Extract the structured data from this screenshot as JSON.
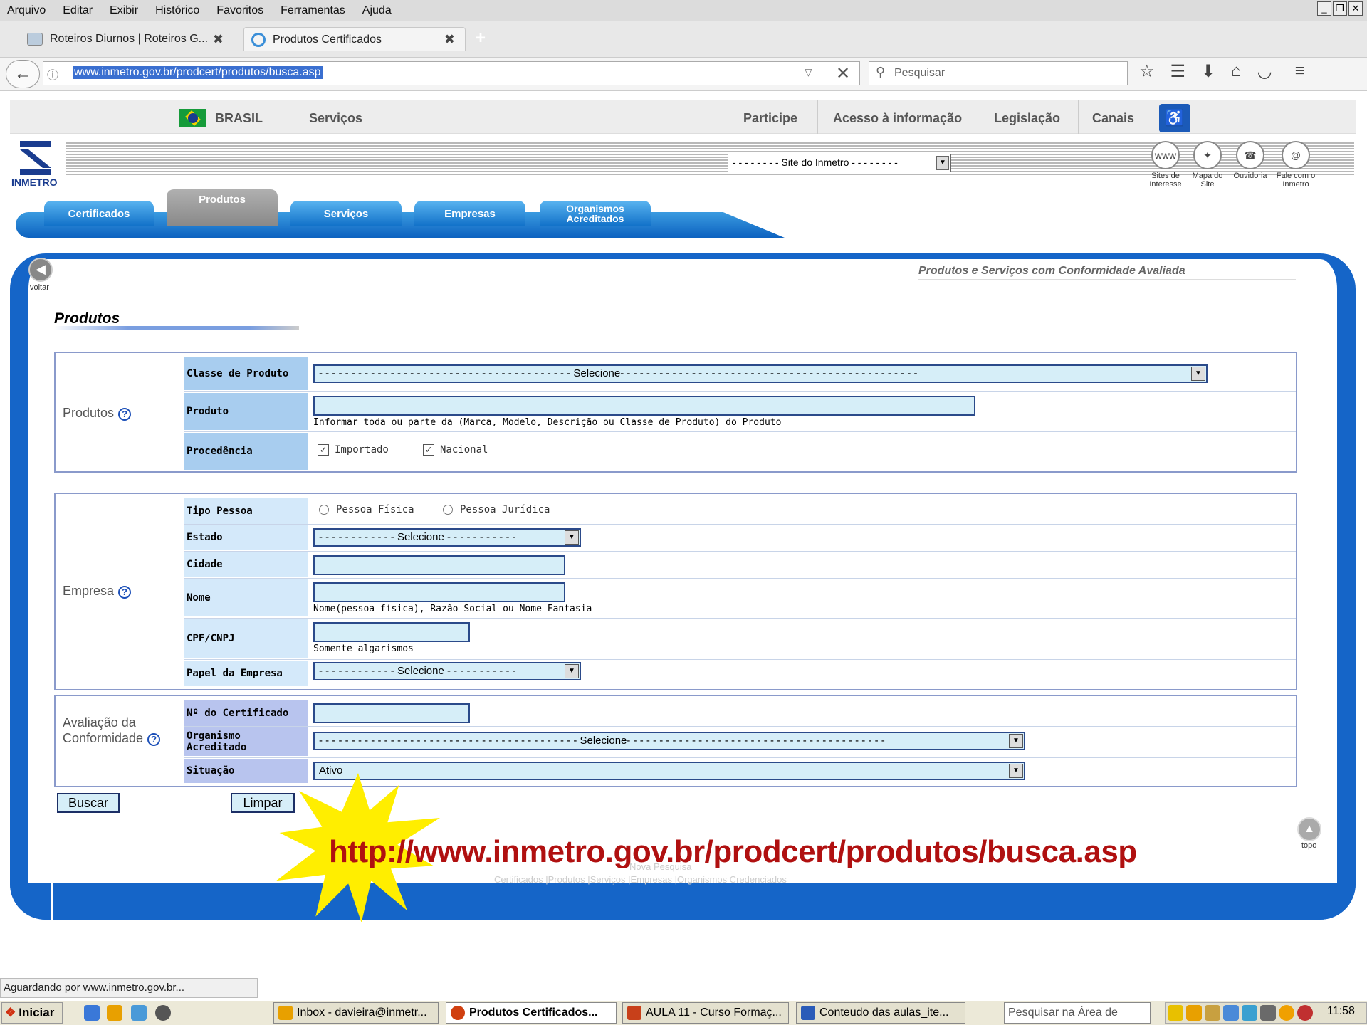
{
  "browser": {
    "menu": [
      "Arquivo",
      "Editar",
      "Exibir",
      "Histórico",
      "Favoritos",
      "Ferramentas",
      "Ajuda"
    ],
    "tabs": [
      {
        "title": "Roteiros Diurnos | Roteiros G...",
        "active": false
      },
      {
        "title": "Produtos Certificados",
        "active": true
      }
    ],
    "url": "www.inmetro.gov.br/prodcert/produtos/busca.asp",
    "search_placeholder": "Pesquisar",
    "status": "Aguardando por www.inmetro.gov.br..."
  },
  "govbar": {
    "brasil": "BRASIL",
    "servicos": "Serviços",
    "participe": "Participe",
    "acesso": "Acesso à informação",
    "legislacao": "Legislação",
    "canais": "Canais"
  },
  "site": {
    "logo": "INMETRO",
    "site_select": "- - - - - - - - Site do Inmetro - - - - - - - -",
    "icons": [
      {
        "label": "Sites de Interesse",
        "glyph": "www"
      },
      {
        "label": "Mapa do Site",
        "glyph": "✦"
      },
      {
        "label": "Ouvidoria",
        "glyph": "☎"
      },
      {
        "label": "Fale com o Inmetro",
        "glyph": "@"
      }
    ],
    "nav": [
      "Certificados",
      "Produtos",
      "Serviços",
      "Empresas",
      "Organismos Acreditados"
    ],
    "voltar": "voltar",
    "subtitle": "Produtos e Serviços com Conformidade Avaliada",
    "page_title": "Produtos",
    "topo": "topo"
  },
  "form": {
    "produtos": {
      "group": "Produtos",
      "classe_label": "Classe de Produto",
      "classe_value": "- - - - - - - - - - - - - - - - - - - - - - - - - - - - - - - - - - - - - - - Selecione- - - - - - - - - - - - - - - - - - - - - - - - - - - - - - - - - - - - - - - - - - - - - -",
      "produto_label": "Produto",
      "produto_hint": "Informar toda ou parte da (Marca, Modelo, Descrição ou Classe de Produto) do Produto",
      "procedencia_label": "Procedência",
      "importado": "Importado",
      "nacional": "Nacional"
    },
    "empresa": {
      "group": "Empresa",
      "tipo_label": "Tipo Pessoa",
      "fisica": "Pessoa Física",
      "juridica": "Pessoa Jurídica",
      "estado_label": "Estado",
      "estado_value": "- - - - - - - - - - - - Selecione - - - - - - - - - - -",
      "cidade_label": "Cidade",
      "nome_label": "Nome",
      "nome_hint": "Nome(pessoa física), Razão Social ou Nome Fantasia",
      "cpf_label": "CPF/CNPJ",
      "cpf_hint": "Somente algarismos",
      "papel_label": "Papel da Empresa",
      "papel_value": "- - - - - - - - - - - - Selecione - - - - - - - - - - -"
    },
    "avaliacao": {
      "group_line1": "Avaliação da",
      "group_line2": "Conformidade",
      "cert_label": "Nº do Certificado",
      "org_label1": "Organismo",
      "org_label2": "Acreditado",
      "org_value": "- - - - - - - - - - - - - - - - - - - - - - - - - - - - - - - - - - - - - - - - Selecione- - - - - - - - - - - - - - - - - - - - - - - - - - - - - - - - - - - - - - - -",
      "sit_label": "Situação",
      "sit_value": "Ativo"
    },
    "buscar": "Buscar",
    "limpar": "Limpar"
  },
  "overlay": {
    "url": "http://www.inmetro.gov.br/prodcert/produtos/busca.asp",
    "nova_pesquisa": "Nova Pesquisa",
    "footer_links": "Certificados  |Produtos  |Serviços  |Empresas  |Organismos Credenciados"
  },
  "taskbar": {
    "start": "Iniciar",
    "tasks": [
      {
        "label": "Inbox - davieira@inmetr...",
        "icon_color": "#e8a000"
      },
      {
        "label": "Produtos Certificados...",
        "icon_color": "#d04010",
        "active": true
      },
      {
        "label": "AULA 11 - Curso Formaç...",
        "icon_color": "#c8401a"
      },
      {
        "label": "Conteudo das aulas_ite...",
        "icon_color": "#2a5bb8"
      }
    ],
    "search_placeholder": "Pesquisar na Área de",
    "clock": "11:58"
  }
}
